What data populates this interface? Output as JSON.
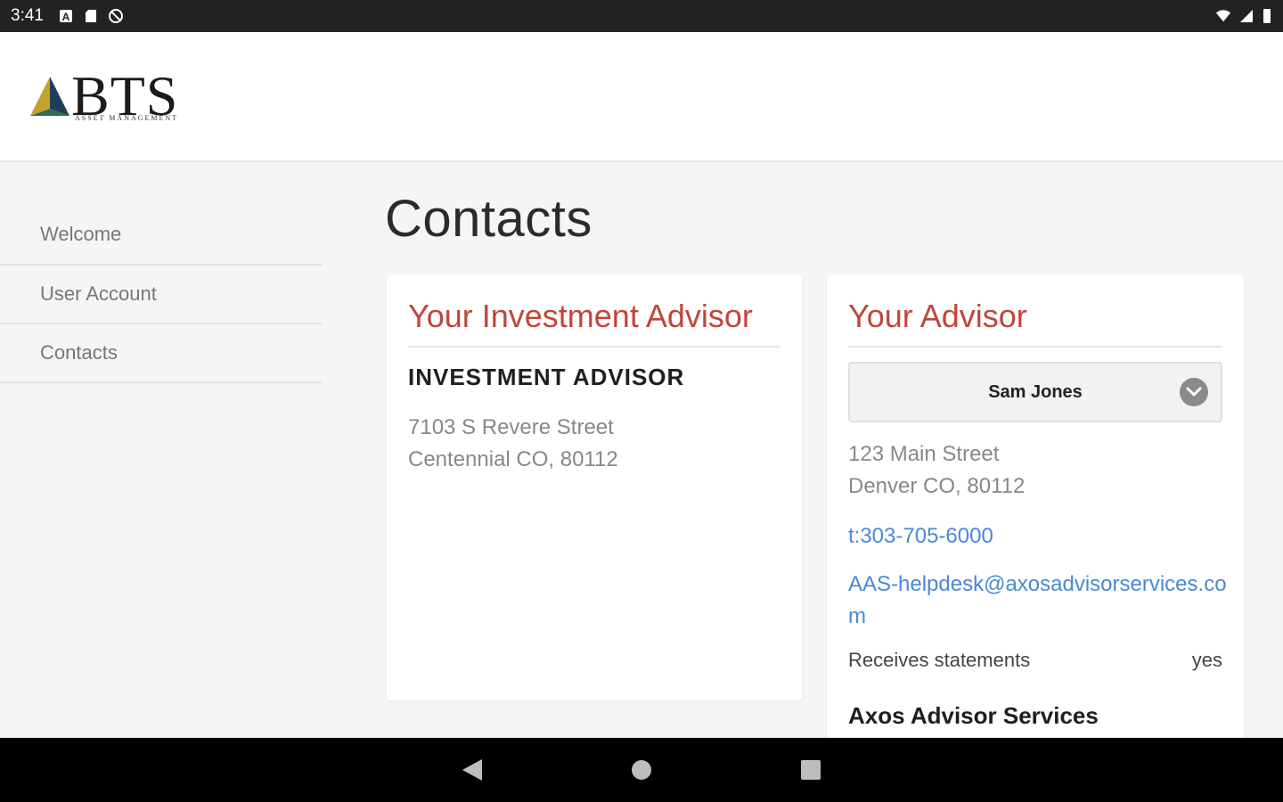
{
  "status_bar": {
    "time": "3:41"
  },
  "header": {
    "logo_text": "BTS",
    "logo_subtext": "ASSET MANAGEMENT"
  },
  "sidebar": {
    "items": [
      {
        "label": "Welcome"
      },
      {
        "label": "User Account"
      },
      {
        "label": "Contacts"
      }
    ]
  },
  "main": {
    "title": "Contacts",
    "investment_advisor_card": {
      "heading": "Your Investment Advisor",
      "name": "INVESTMENT ADVISOR",
      "address_line1": "7103 S Revere Street",
      "address_line2": "Centennial CO, 80112"
    },
    "advisor_card": {
      "heading": "Your Advisor",
      "selected_advisor": "Sam Jones",
      "address_line1": "123 Main Street",
      "address_line2": "Denver CO, 80112",
      "phone": "t:303-705-6000",
      "email": "AAS-helpdesk@axosadvisorservices.com",
      "receives_statements_label": "Receives statements",
      "receives_statements_value": "yes",
      "firm": "Axos Advisor Services"
    }
  },
  "colors": {
    "accent_heading": "#c0463a",
    "link": "#4a88d6"
  }
}
